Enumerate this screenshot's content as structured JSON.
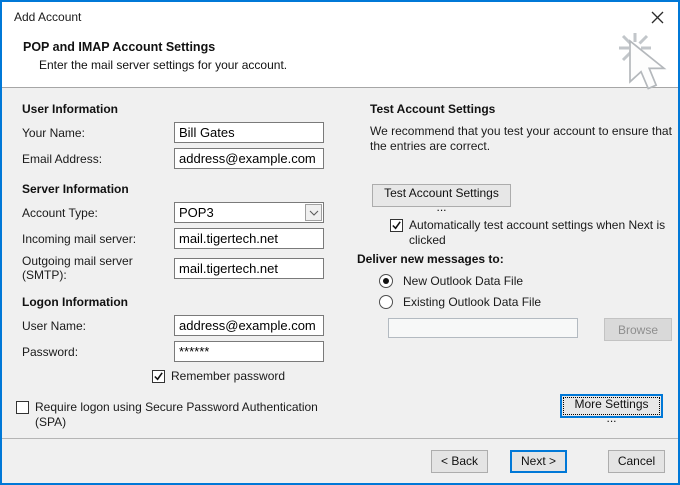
{
  "window": {
    "title": "Add Account"
  },
  "header": {
    "title": "POP and IMAP Account Settings",
    "subtitle": "Enter the mail server settings for your account."
  },
  "user_info": {
    "heading": "User Information",
    "your_name_label": "Your Name:",
    "your_name_value": "Bill Gates",
    "email_label": "Email Address:",
    "email_value": "address@example.com"
  },
  "server_info": {
    "heading": "Server Information",
    "account_type_label": "Account Type:",
    "account_type_value": "POP3",
    "incoming_label": "Incoming mail server:",
    "incoming_value": "mail.tigertech.net",
    "outgoing_label": "Outgoing mail server (SMTP):",
    "outgoing_value": "mail.tigertech.net"
  },
  "logon_info": {
    "heading": "Logon Information",
    "user_name_label": "User Name:",
    "user_name_value": "address@example.com",
    "password_label": "Password:",
    "password_value": "******",
    "remember_password_label": "Remember password",
    "spa_label": "Require logon using Secure Password Authentication (SPA)"
  },
  "test": {
    "heading": "Test Account Settings",
    "description": "We recommend that you test your account to ensure that the entries are correct.",
    "button_label": "Test Account Settings ...",
    "auto_test_label": "Automatically test account settings when Next is clicked"
  },
  "deliver": {
    "heading": "Deliver new messages to:",
    "new_data_file_label": "New Outlook Data File",
    "existing_data_file_label": "Existing Outlook Data File",
    "existing_path_value": "",
    "browse_label": "Browse"
  },
  "more_settings_label": "More Settings ...",
  "footer": {
    "back_label": "< Back",
    "next_label": "Next >",
    "cancel_label": "Cancel"
  },
  "colors": {
    "accent": "#0078d7",
    "header_bg": "#ffffff",
    "body_bg": "#f0f0f0",
    "input_border": "#7a7a7a"
  }
}
